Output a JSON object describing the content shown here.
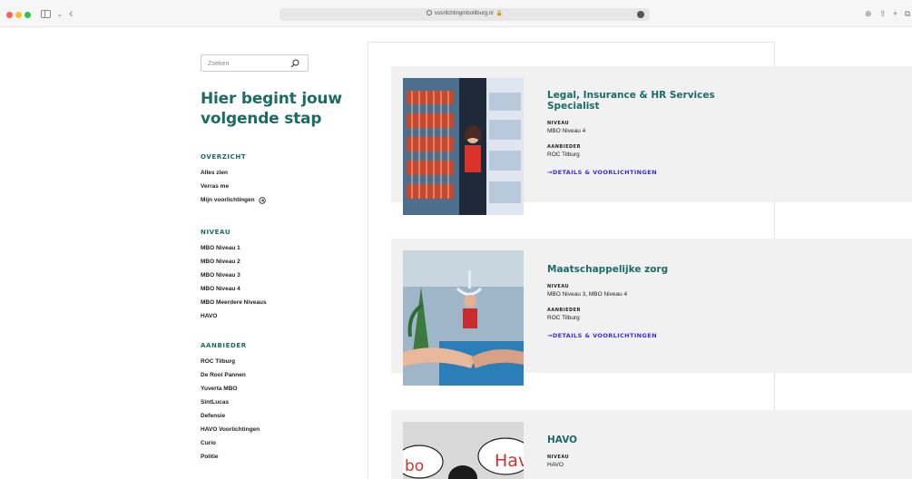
{
  "browser": {
    "url": "voorlichtingmbotilburg.nl"
  },
  "search": {
    "placeholder": "Zoeken"
  },
  "hero": {
    "title": "Hier begint jouw volgende stap"
  },
  "overzicht": {
    "heading": "OVERZICHT",
    "items": [
      "Alles zien",
      "Verras me",
      "Mijn voorlichtingen"
    ]
  },
  "niveau": {
    "heading": "NIVEAU",
    "items": [
      "MBO Niveau 1",
      "MBO Niveau 2",
      "MBO Niveau 3",
      "MBO Niveau 4",
      "MBO Meerdere Niveaus",
      "HAVO"
    ]
  },
  "aanbieder": {
    "heading": "AANBIEDER",
    "items": [
      "ROC Tilburg",
      "De Rooi Pannen",
      "Yuverta MBO",
      "SintLucas",
      "Defensie",
      "HAVO Voorlichtingen",
      "Curio",
      "Politie"
    ]
  },
  "cards": [
    {
      "title": "Legal, Insurance & HR Services Specialist",
      "niveau_label": "NIVEAU",
      "niveau": "MBO Niveau 4",
      "aanbieder_label": "AANBIEDER",
      "aanbieder": "ROC Tilburg",
      "link": "→DETAILS & VOORLICHTINGEN"
    },
    {
      "title": "Maatschappelijke zorg",
      "niveau_label": "NIVEAU",
      "niveau": "MBO Niveau 3, MBO Niveau 4",
      "aanbieder_label": "AANBIEDER",
      "aanbieder": "ROC Tilburg",
      "link": "→DETAILS & VOORLICHTINGEN"
    },
    {
      "title": "HAVO",
      "niveau_label": "NIVEAU",
      "niveau": "HAVO",
      "image_text_left": "bo",
      "image_text_right": "Hav"
    }
  ],
  "colors": {
    "brand_teal": "#1c6b64",
    "link_purple": "#3b2be0",
    "card_bg": "#f1f1f1"
  }
}
